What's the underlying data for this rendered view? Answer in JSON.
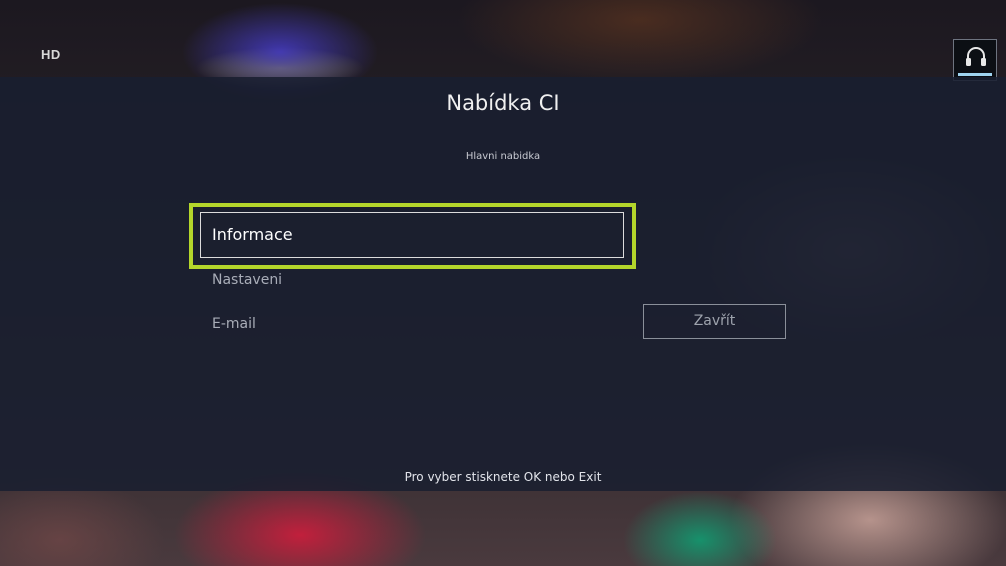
{
  "header": {
    "hd_badge": "HD",
    "headset_icon": "headset-icon",
    "headset_level": 1.0
  },
  "dialog": {
    "title": "Nabídka CI",
    "subtitle": "Hlavni nabidka",
    "menu": [
      {
        "label": "Informace",
        "selected": true
      },
      {
        "label": "Nastaveni",
        "selected": false
      },
      {
        "label": "E-mail",
        "selected": false
      }
    ],
    "close_label": "Zavřít",
    "hint": "Pro vyber stisknete OK nebo Exit"
  },
  "colors": {
    "focus": "#b4d62b",
    "overlay": "#181e30",
    "text": "#ffffff",
    "muted_text": "#a9adb8"
  }
}
